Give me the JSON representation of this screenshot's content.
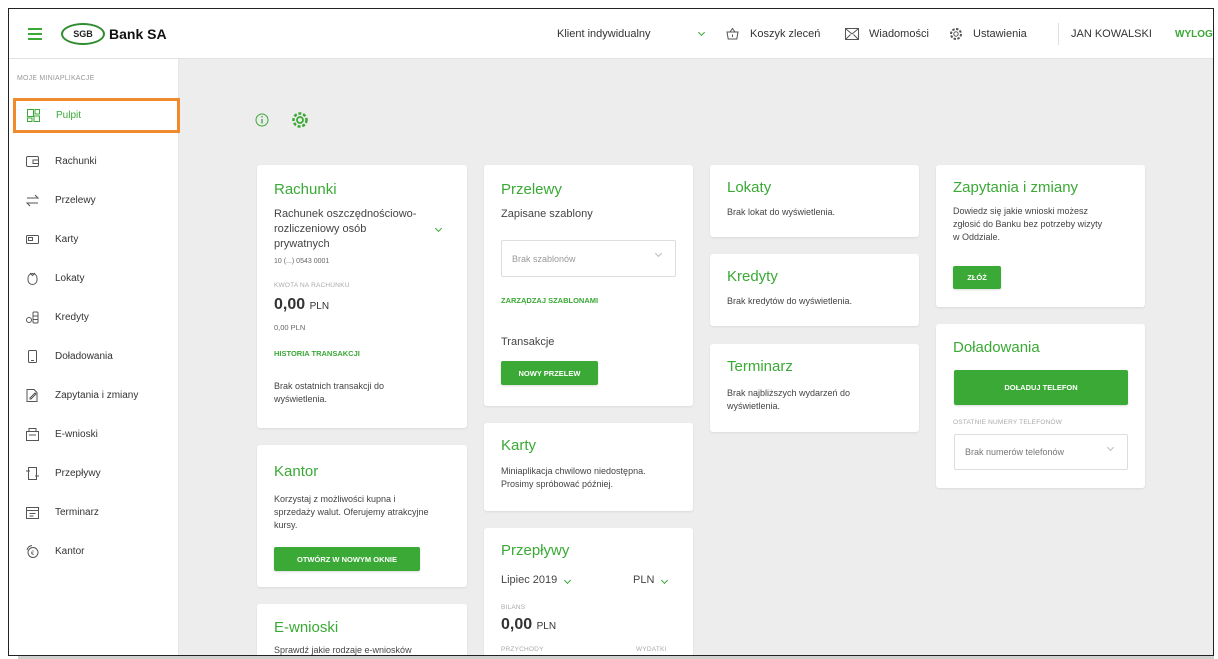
{
  "header": {
    "brand_short": "SGB",
    "brand_name": "Bank SA",
    "client_type": "Klient indywidualny",
    "cart": "Koszyk zleceń",
    "messages": "Wiadomości",
    "settings": "Ustawienia",
    "user": "JAN KOWALSKI",
    "logout": "WYLOGU"
  },
  "sidebar": {
    "header": "MOJE MINIAPLIKACJE",
    "items": [
      {
        "label": "Pulpit",
        "icon": "dashboard-icon"
      },
      {
        "label": "Rachunki",
        "icon": "wallet-icon"
      },
      {
        "label": "Przelewy",
        "icon": "transfer-icon"
      },
      {
        "label": "Karty",
        "icon": "card-icon"
      },
      {
        "label": "Lokaty",
        "icon": "deposit-icon"
      },
      {
        "label": "Kredyty",
        "icon": "coins-icon"
      },
      {
        "label": "Doładowania",
        "icon": "phone-icon"
      },
      {
        "label": "Zapytania i zmiany",
        "icon": "edit-doc-icon"
      },
      {
        "label": "E-wnioski",
        "icon": "forms-icon"
      },
      {
        "label": "Przepływy",
        "icon": "flow-icon"
      },
      {
        "label": "Terminarz",
        "icon": "calendar-icon"
      },
      {
        "label": "Kantor",
        "icon": "exchange-icon"
      }
    ]
  },
  "widgets": {
    "rachunki": {
      "title": "Rachunki",
      "account_line1": "Rachunek oszczędnościowo-",
      "account_line2": "rozliczeniowy osób",
      "account_line3": "prywatnych",
      "account_number": "10 (...) 0543 0001",
      "amount_label": "KWOTA NA RACHUNKU",
      "amount": "0,00",
      "currency": "PLN",
      "amount_sub": "0,00 PLN",
      "history_link": "HISTORIA TRANSAKCJI",
      "empty_line1": "Brak ostatnich transakcji do",
      "empty_line2": "wyświetlenia."
    },
    "przelewy": {
      "title": "Przelewy",
      "saved_label": "Zapisane szablony",
      "select_placeholder": "Brak szablonów",
      "manage_link": "ZARZĄDZAJ SZABLONAMI",
      "transactions_label": "Transakcje",
      "new_button": "NOWY PRZELEW"
    },
    "lokaty": {
      "title": "Lokaty",
      "empty": "Brak lokat do wyświetlenia."
    },
    "kredyty": {
      "title": "Kredyty",
      "empty": "Brak kredytów do wyświetlenia."
    },
    "terminarz": {
      "title": "Terminarz",
      "empty_line1": "Brak najbliższych wydarzeń do",
      "empty_line2": "wyświetlenia."
    },
    "zapytania": {
      "title": "Zapytania i zmiany",
      "line1": "Dowiedz się jakie wnioski możesz",
      "line2": "zgłosić do Banku bez potrzeby wizyty",
      "line3": "w Oddziale.",
      "button": "ZŁÓŻ"
    },
    "doladowania": {
      "title": "Doładowania",
      "button": "DOŁADUJ TELEFON",
      "recent_label": "OSTATNIE NUMERY TELEFONÓW",
      "select_placeholder": "Brak numerów telefonów"
    },
    "kantor": {
      "title": "Kantor",
      "line1": "Korzystaj z możliwości kupna i",
      "line2": "sprzedaży walut. Oferujemy atrakcyjne",
      "line3": "kursy.",
      "button": "OTWÓRZ W NOWYM OKNIE"
    },
    "karty": {
      "title": "Karty",
      "line1": "Miniaplikacja chwilowo niedostępna.",
      "line2": "Prosimy spróbować później."
    },
    "przeplywy": {
      "title": "Przepływy",
      "period": "Lipiec 2019",
      "currency": "PLN",
      "balance_label": "BILANS",
      "balance": "0,00",
      "balance_currency": "PLN",
      "income_label": "PRZYCHODY",
      "expense_label": "WYDATKI"
    },
    "ewnioski": {
      "title": "E-wnioski",
      "line1": "Sprawdź jakie rodzaje e-wniosków"
    }
  },
  "colors": {
    "accent": "#3aa935",
    "highlight": "#f08a2c"
  }
}
